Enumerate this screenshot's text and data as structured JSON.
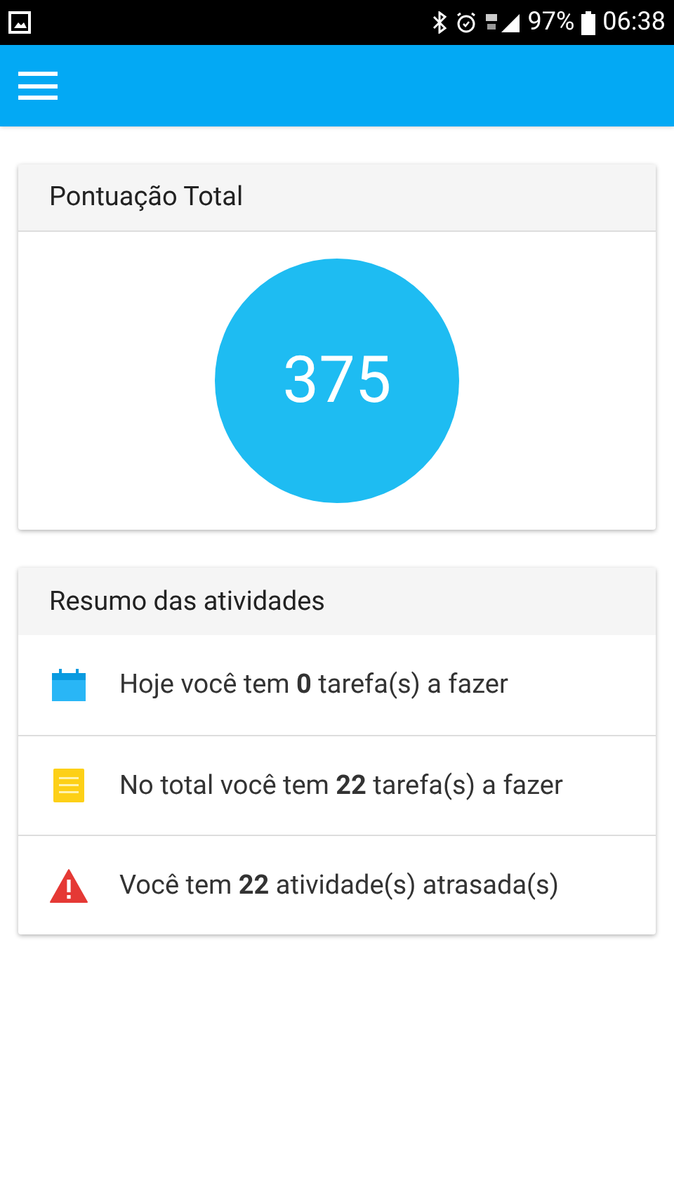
{
  "status_bar": {
    "battery": "97%",
    "time": "06:38"
  },
  "score_card": {
    "title": "Pontuação Total",
    "score": "375"
  },
  "summary_card": {
    "title": "Resumo das atividades",
    "items": [
      {
        "kind": "calendar",
        "text": "Hoje você tem **0** tarefa(s) a fazer"
      },
      {
        "kind": "list",
        "text": "No total você tem **22** tarefa(s) a fazer"
      },
      {
        "kind": "warning",
        "text": "Você tem **22** atividade(s) atrasada(s)"
      }
    ]
  }
}
